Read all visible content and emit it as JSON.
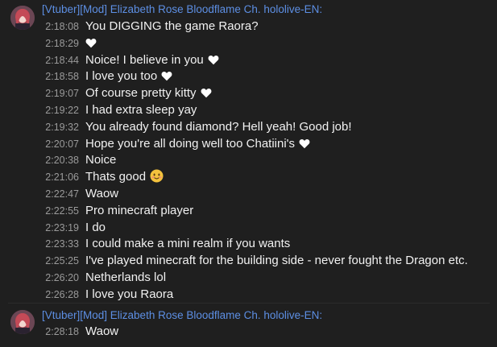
{
  "groups": [
    {
      "author": "[Vtuber][Mod] Elizabeth Rose Bloodflame Ch. hololive-EN:",
      "messages": [
        {
          "time": "2:18:08",
          "text": "You DIGGING the game Raora?",
          "emoji": ""
        },
        {
          "time": "2:18:29",
          "text": "",
          "emoji": "white-heart"
        },
        {
          "time": "2:18:44",
          "text": "Noice! I believe in you",
          "emoji": "white-heart"
        },
        {
          "time": "2:18:58",
          "text": "I love you too",
          "emoji": "white-heart"
        },
        {
          "time": "2:19:07",
          "text": "Of course pretty kitty",
          "emoji": "white-heart"
        },
        {
          "time": "2:19:22",
          "text": "I had extra sleep yay",
          "emoji": ""
        },
        {
          "time": "2:19:32",
          "text": "You already found diamond? Hell yeah! Good job!",
          "emoji": ""
        },
        {
          "time": "2:20:07",
          "text": "Hope you're all doing well too Chatiini's",
          "emoji": "white-heart"
        },
        {
          "time": "2:20:38",
          "text": "Noice",
          "emoji": ""
        },
        {
          "time": "2:21:06",
          "text": "Thats good",
          "emoji": "smiling-face"
        },
        {
          "time": "2:22:47",
          "text": "Waow",
          "emoji": ""
        },
        {
          "time": "2:22:55",
          "text": "Pro minecraft player",
          "emoji": ""
        },
        {
          "time": "2:23:19",
          "text": "I do",
          "emoji": ""
        },
        {
          "time": "2:23:33",
          "text": "I could make a mini realm if you wants",
          "emoji": ""
        },
        {
          "time": "2:25:25",
          "text": "I've played minecraft for the building side - never fought the Dragon etc.",
          "emoji": ""
        },
        {
          "time": "2:26:20",
          "text": "Netherlands lol",
          "emoji": ""
        },
        {
          "time": "2:26:28",
          "text": "I love you Raora",
          "emoji": ""
        }
      ]
    },
    {
      "author": "[Vtuber][Mod] Elizabeth Rose Bloodflame Ch. hololive-EN:",
      "messages": [
        {
          "time": "2:28:18",
          "text": "Waow",
          "emoji": ""
        }
      ]
    }
  ],
  "colors": {
    "background": "#1f1f1f",
    "author": "#5d8fe4",
    "timestamp": "#9a9a9a",
    "text": "#f1f1f1"
  }
}
